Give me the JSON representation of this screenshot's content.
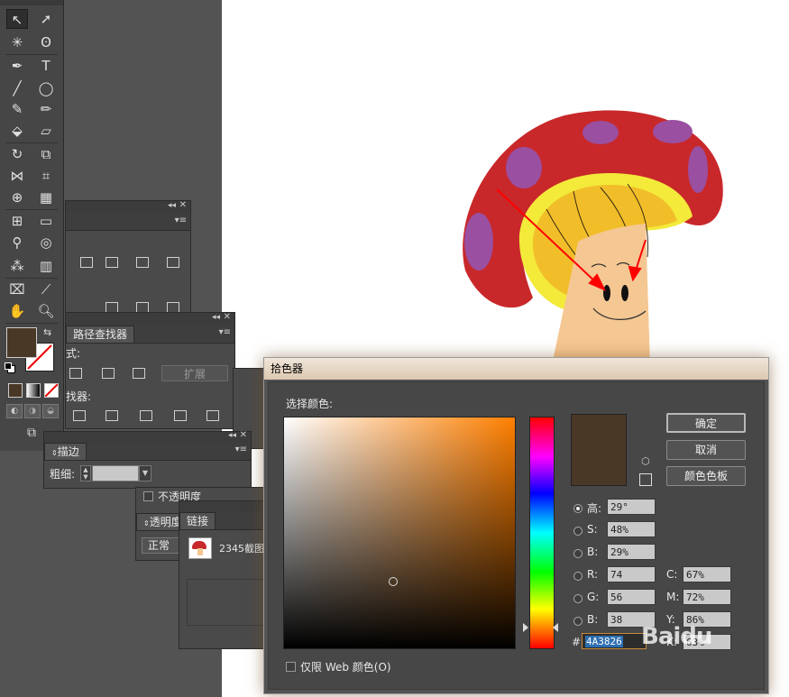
{
  "colors": {
    "selected": "#4A3826",
    "mushroom_cap": "#C8282A",
    "cap_spots": "#9A4FA0",
    "gills_rim": "#F3EA3A",
    "gills": "#F1BE2A",
    "stem": "#F5C792"
  },
  "panels": {
    "pathfinder": {
      "tab": "路径查找器",
      "shape_mode_label": "式:",
      "pathfinder_label": "找器:",
      "expand_button": "扩展"
    },
    "stroke": {
      "tab": "描边",
      "weight_label": "粗细:"
    },
    "transparency": {
      "tab": "透明度",
      "opacity_label": "不透明度",
      "blend_mode": "正常"
    },
    "links": {
      "tab": "链接",
      "item_name": "2345截图"
    }
  },
  "color_picker": {
    "title": "拾色器",
    "select_color_label": "选择颜色:",
    "ok": "确定",
    "cancel": "取消",
    "swatches": "颜色色板",
    "fields": {
      "H": {
        "label": "高:",
        "value": "29°"
      },
      "S": {
        "label": "S:",
        "value": "48%"
      },
      "Bv": {
        "label": "B:",
        "value": "29%"
      },
      "R": {
        "label": "R:",
        "value": "74"
      },
      "G": {
        "label": "G:",
        "value": "56"
      },
      "Bc": {
        "label": "B:",
        "value": "38"
      },
      "C": {
        "label": "C:",
        "value": "67%"
      },
      "M": {
        "label": "M:",
        "value": "72%"
      },
      "Y": {
        "label": "Y:",
        "value": "86%"
      },
      "K": {
        "label": "K:",
        "value": "63%"
      }
    },
    "hex_label": "#",
    "hex_value": "4A3826",
    "web_only_label": "仅限 Web 颜色(O)"
  },
  "watermark": "Baidu"
}
